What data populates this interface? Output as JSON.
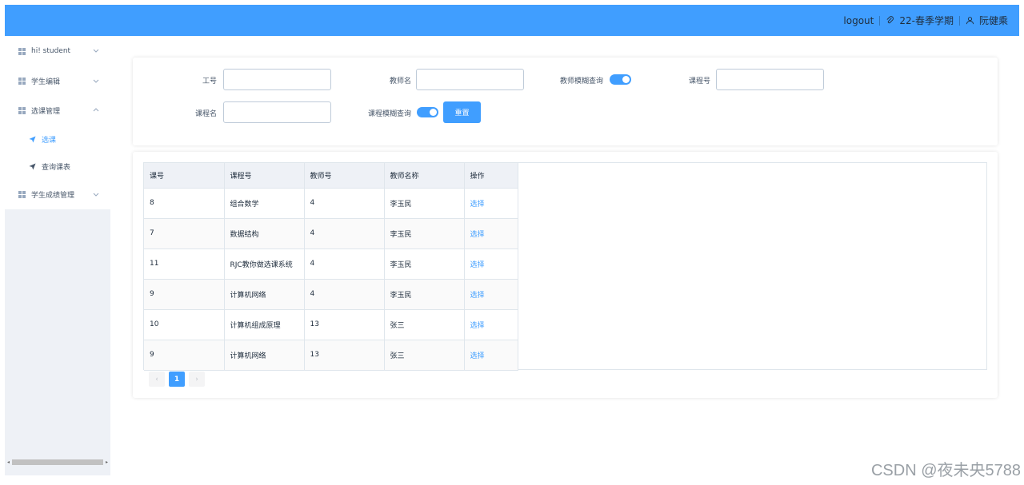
{
  "header": {
    "logout": "logout",
    "term": "22-春季学期",
    "user": "阮健乘",
    "color": "#409eff"
  },
  "sidebar": {
    "items": [
      {
        "label": "hi! student"
      },
      {
        "label": "学生编辑"
      },
      {
        "label": "选课管理"
      },
      {
        "label": "学生成绩管理"
      }
    ],
    "subitems": [
      {
        "label": "选课"
      },
      {
        "label": "查询课表"
      }
    ]
  },
  "search": {
    "staff_id_label": "工号",
    "teacher_name_label": "教师名",
    "teacher_fuzzy_label": "教师模糊查询",
    "course_id_label": "课程号",
    "course_name_label": "课程名",
    "course_fuzzy_label": "课程模糊查询",
    "reset_label": "重置"
  },
  "table": {
    "headers": [
      "课号",
      "课程号",
      "教师号",
      "教师名称",
      "操作"
    ],
    "rows": [
      {
        "c0": "8",
        "c1": "组合数学",
        "c2": "4",
        "c3": "李玉民",
        "c4": "选择"
      },
      {
        "c0": "7",
        "c1": "数据结构",
        "c2": "4",
        "c3": "李玉民",
        "c4": "选择"
      },
      {
        "c0": "11",
        "c1": "RJC教你做选课系统",
        "c2": "4",
        "c3": "李玉民",
        "c4": "选择"
      },
      {
        "c0": "9",
        "c1": "计算机网络",
        "c2": "4",
        "c3": "李玉民",
        "c4": "选择"
      },
      {
        "c0": "10",
        "c1": "计算机组成原理",
        "c2": "13",
        "c3": "张三",
        "c4": "选择"
      },
      {
        "c0": "9",
        "c1": "计算机网络",
        "c2": "13",
        "c3": "张三",
        "c4": "选择"
      }
    ]
  },
  "pagination": {
    "prev": "‹",
    "current": "1",
    "next": "›"
  },
  "watermark": "CSDN @夜未央5788"
}
